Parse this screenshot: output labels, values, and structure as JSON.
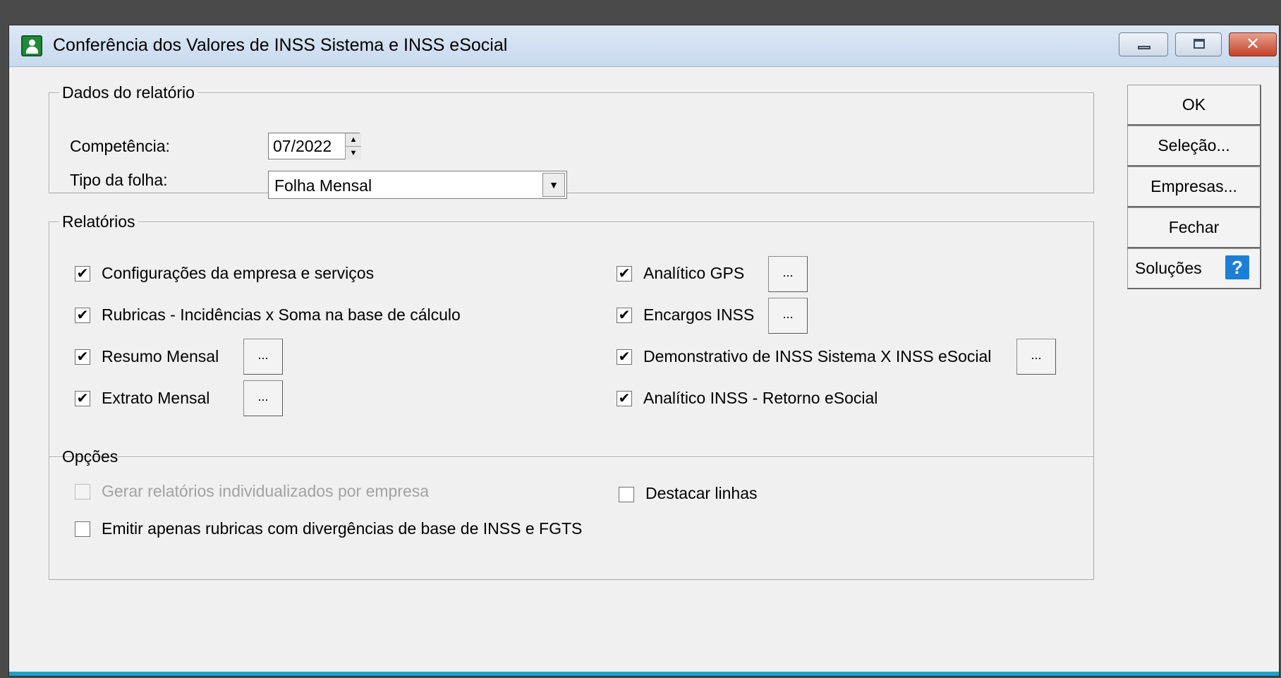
{
  "window": {
    "title": "Conferência dos Valores de INSS Sistema e INSS eSocial",
    "close_glyph": "✕"
  },
  "dados": {
    "legend": "Dados do relatório",
    "competencia_label": "Competência:",
    "competencia_value": "07/2022",
    "tipo_label": "Tipo da folha:",
    "tipo_value": "Folha Mensal"
  },
  "relatorios": {
    "legend": "Relatórios",
    "items": [
      {
        "label": "Configurações da empresa e serviços",
        "checked": true
      },
      {
        "label": "Rubricas - Incidências x Soma na base de cálculo",
        "checked": true
      },
      {
        "label": "Resumo Mensal",
        "checked": true
      },
      {
        "label": "Extrato Mensal",
        "checked": true
      },
      {
        "label": "Analítico GPS",
        "checked": true
      },
      {
        "label": "Encargos INSS",
        "checked": true
      },
      {
        "label": "Demonstrativo de INSS Sistema X INSS eSocial",
        "checked": true
      },
      {
        "label": "Analítico INSS - Retorno eSocial",
        "checked": true
      }
    ],
    "ellipsis": "..."
  },
  "opcoes": {
    "legend": "Opções",
    "gerar_label": "Gerar relatórios individualizados por empresa",
    "emitir_label": "Emitir apenas rubricas com divergências de base de INSS e FGTS",
    "destacar_label": "Destacar linhas"
  },
  "buttons": {
    "ok": "OK",
    "selecao": "Seleção...",
    "empresas": "Empresas...",
    "fechar": "Fechar",
    "solucoes": "Soluções"
  },
  "icons": {
    "check": "✔",
    "help": "?",
    "spin_up": "▲",
    "spin_down": "▼",
    "dropdown": "▼"
  }
}
